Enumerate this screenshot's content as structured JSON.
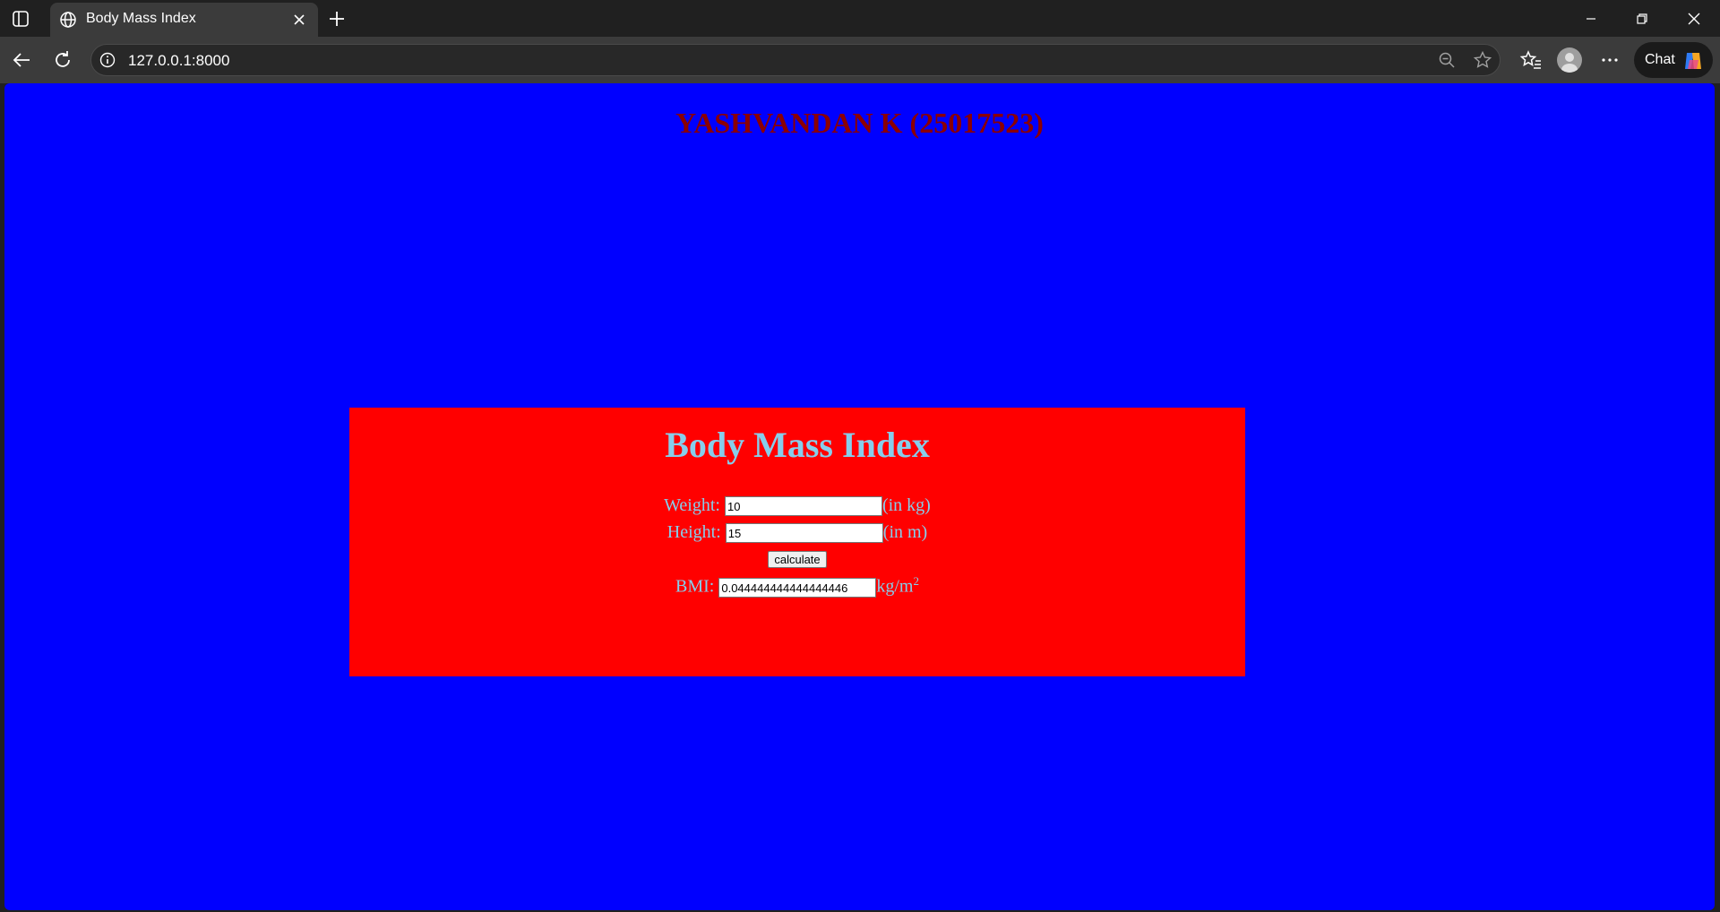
{
  "browser": {
    "tab_title": "Body Mass Index",
    "url": "127.0.0.1:8000",
    "chat_label": "Chat"
  },
  "page": {
    "heading": "YASHVANDAN K (25017523)",
    "card_title": "Body Mass Index",
    "weight": {
      "label": "Weight: ",
      "value": "10",
      "unit": "(in kg)"
    },
    "height": {
      "label": "Height: ",
      "value": "15",
      "unit": "(in m)"
    },
    "calculate_label": "calculate",
    "bmi": {
      "label": "BMI: ",
      "value": "0.044444444444444446",
      "unit": "kg/m",
      "unit_sup": "2"
    }
  },
  "colors": {
    "page_bg": "#0000ff",
    "card_bg": "#ff0000",
    "heading": "#8b0000",
    "card_text": "#87ceeb"
  }
}
